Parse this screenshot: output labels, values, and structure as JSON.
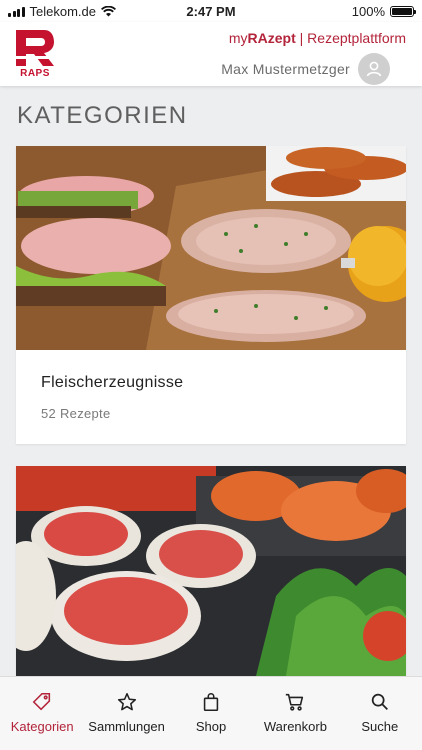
{
  "status_bar": {
    "carrier": "Telekom.de",
    "time": "2:47 PM",
    "battery": "100%"
  },
  "header": {
    "logo_text": "RAPS",
    "platform_prefix": "my",
    "platform_brand": "RAzept",
    "platform_separator": "|",
    "platform_suffix": "Rezeptplattform",
    "user_name": "Max Mustermetzger"
  },
  "main": {
    "section_title": "KATEGORIEN",
    "categories": [
      {
        "title": "Fleischerzeugnisse",
        "count": "52 Rezepte"
      },
      {
        "title": "",
        "count": ""
      }
    ]
  },
  "tab_bar": {
    "items": [
      {
        "label": "Kategorien",
        "icon": "tag-icon",
        "active": true
      },
      {
        "label": "Sammlungen",
        "icon": "star-icon",
        "active": false
      },
      {
        "label": "Shop",
        "icon": "bag-icon",
        "active": false
      },
      {
        "label": "Warenkorb",
        "icon": "cart-icon",
        "active": false
      },
      {
        "label": "Suche",
        "icon": "search-icon",
        "active": false
      }
    ]
  },
  "colors": {
    "brand_red": "#c4122f",
    "accent": "#b3243a",
    "background": "#edeef0"
  }
}
